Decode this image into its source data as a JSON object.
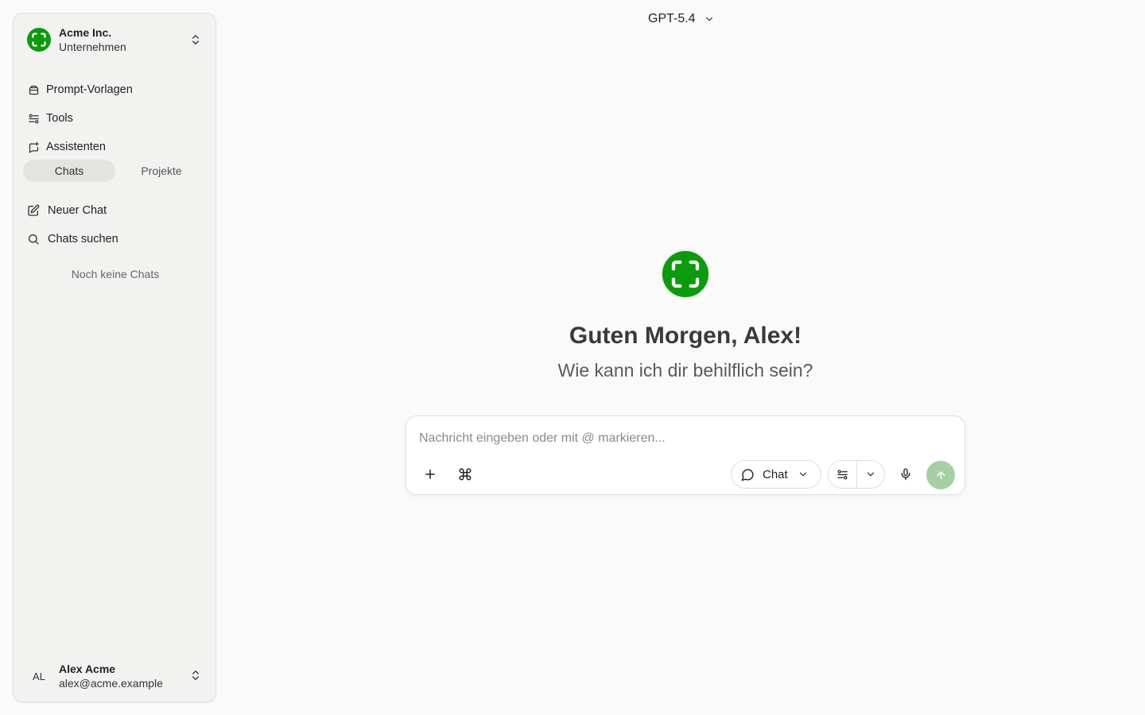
{
  "sidebar": {
    "org": {
      "name": "Acme Inc.",
      "subtitle": "Unternehmen",
      "logo_icon": "frame-icon"
    },
    "nav": [
      {
        "label": "Prompt-Vorlagen",
        "icon": "prompt-template-icon"
      },
      {
        "label": "Tools",
        "icon": "tools-icon"
      },
      {
        "label": "Assistenten",
        "icon": "assistant-icon"
      }
    ],
    "segments": {
      "chats": "Chats",
      "projects": "Projekte",
      "active": "chats"
    },
    "actions": {
      "new_chat": "Neuer Chat",
      "search_chats": "Chats suchen"
    },
    "empty_text": "Noch keine Chats",
    "user": {
      "initials": "AL",
      "name": "Alex Acme",
      "email": "alex@acme.example"
    }
  },
  "header": {
    "model": "GPT-5.4"
  },
  "hero": {
    "greeting": "Guten Morgen, Alex!",
    "subtitle": "Wie kann ich dir behilflich sein?"
  },
  "composer": {
    "placeholder": "Nachricht eingeben oder mit @ markieren...",
    "mode_label": "Chat"
  },
  "colors": {
    "brand": "#0b9b0b",
    "send_disabled": "#a6cfa6",
    "sidebar_bg": "#f2f3f1",
    "page_bg": "#fafafa"
  }
}
